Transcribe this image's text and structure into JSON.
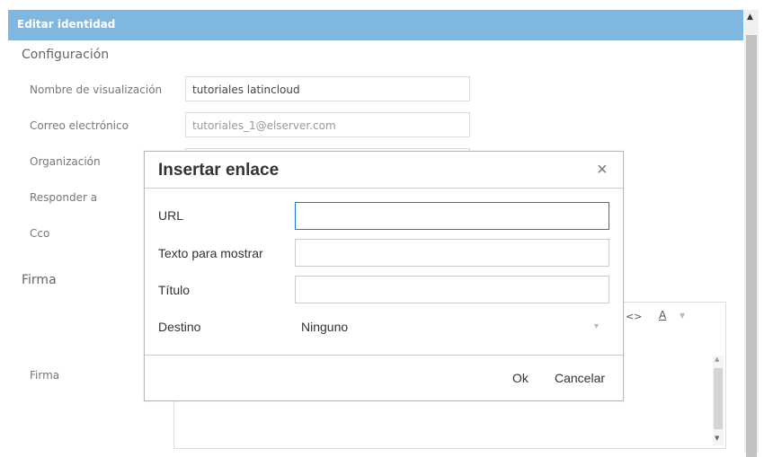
{
  "header": {
    "title": "Editar identidad"
  },
  "sections": {
    "config": "Configuración",
    "firma": "Firma"
  },
  "fields": {
    "display_name": {
      "label": "Nombre de visualización",
      "value": "tutoriales latincloud"
    },
    "email": {
      "label": "Correo electrónico",
      "value": "tutoriales_1@elserver.com"
    },
    "organization": {
      "label": "Organización"
    },
    "reply_to": {
      "label": "Responder a"
    },
    "bcc": {
      "label": "Cco"
    },
    "signature": {
      "label": "Firma"
    }
  },
  "editor_toolbar": {
    "code": "<>",
    "text_color": "A"
  },
  "dialog": {
    "title": "Insertar enlace",
    "close": "×",
    "url_label": "URL",
    "text_label": "Texto para mostrar",
    "title_label": "Título",
    "target_label": "Destino",
    "target_value": "Ninguno",
    "ok": "Ok",
    "cancel": "Cancelar"
  },
  "colors": {
    "header_bg": "#7fb7e1",
    "focus_border": "#2276d2"
  }
}
